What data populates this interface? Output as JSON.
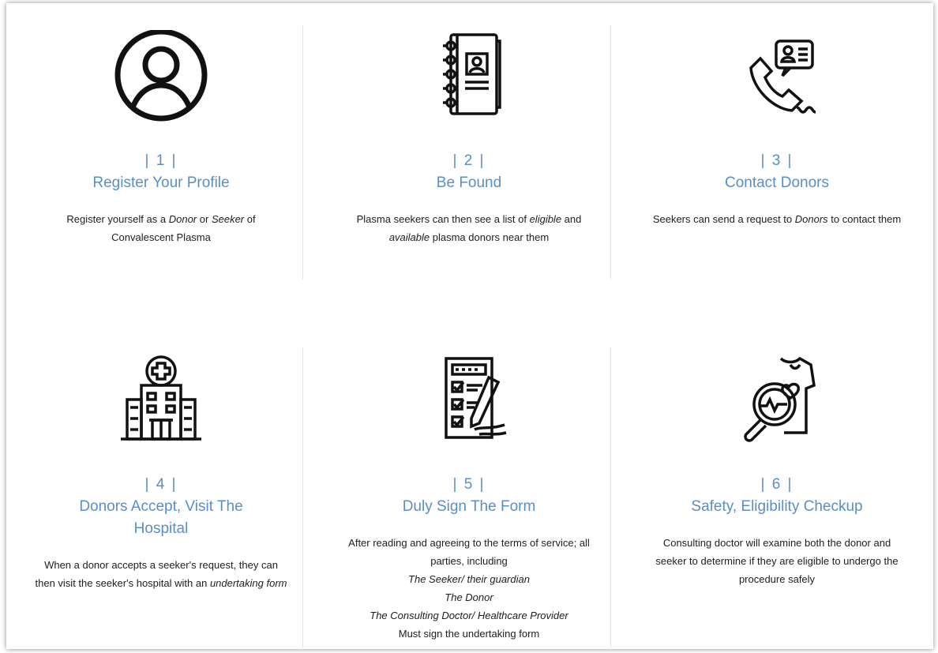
{
  "steps": [
    {
      "number": "| 1 |",
      "title": "Register Your Profile",
      "icon": "user-profile-icon",
      "desc": {
        "t1": "Register yourself as a ",
        "i1": "Donor",
        "t2": " or ",
        "i2": "Seeker",
        "t3": " of Convalescent Plasma"
      }
    },
    {
      "number": "| 2 |",
      "title": "Be Found",
      "icon": "address-book-icon",
      "desc": {
        "t1": "Plasma seekers can then see a list of ",
        "i1": "eligible",
        "t2": " and ",
        "i2": "available",
        "t3": " plasma donors near them"
      }
    },
    {
      "number": "| 3 |",
      "title": "Contact Donors",
      "icon": "phone-contact-icon",
      "desc": {
        "t1": "Seekers can send a request to ",
        "i1": "Donors",
        "t2": " to contact them"
      }
    },
    {
      "number": "| 4 |",
      "title": "Donors Accept, Visit The Hospital",
      "icon": "hospital-icon",
      "desc": {
        "t1": "When a donor accepts a seeker's request, they can then visit the seeker's hospital with an ",
        "i1": "undertaking form"
      }
    },
    {
      "number": "| 5 |",
      "title": "Duly Sign The Form",
      "icon": "sign-form-icon",
      "desc": {
        "t1": "After reading and agreeing to the terms of service; all parties, including",
        "i1": "The Seeker/ their guardian",
        "i2": "The Donor",
        "i3": "The Consulting Doctor/ Healthcare Provider",
        "t2": "Must sign the undertaking form"
      }
    },
    {
      "number": "| 6 |",
      "title": "Safety, Eligibility Checkup",
      "icon": "health-checkup-icon",
      "desc": {
        "t1": "Consulting doctor will examine both the donor and seeker to determine if they are eligible to undergo the procedure safely"
      }
    }
  ],
  "colors": {
    "accent": "#5b8ec4",
    "text": "#1e1e1e",
    "divider": "#e4e4e4"
  }
}
